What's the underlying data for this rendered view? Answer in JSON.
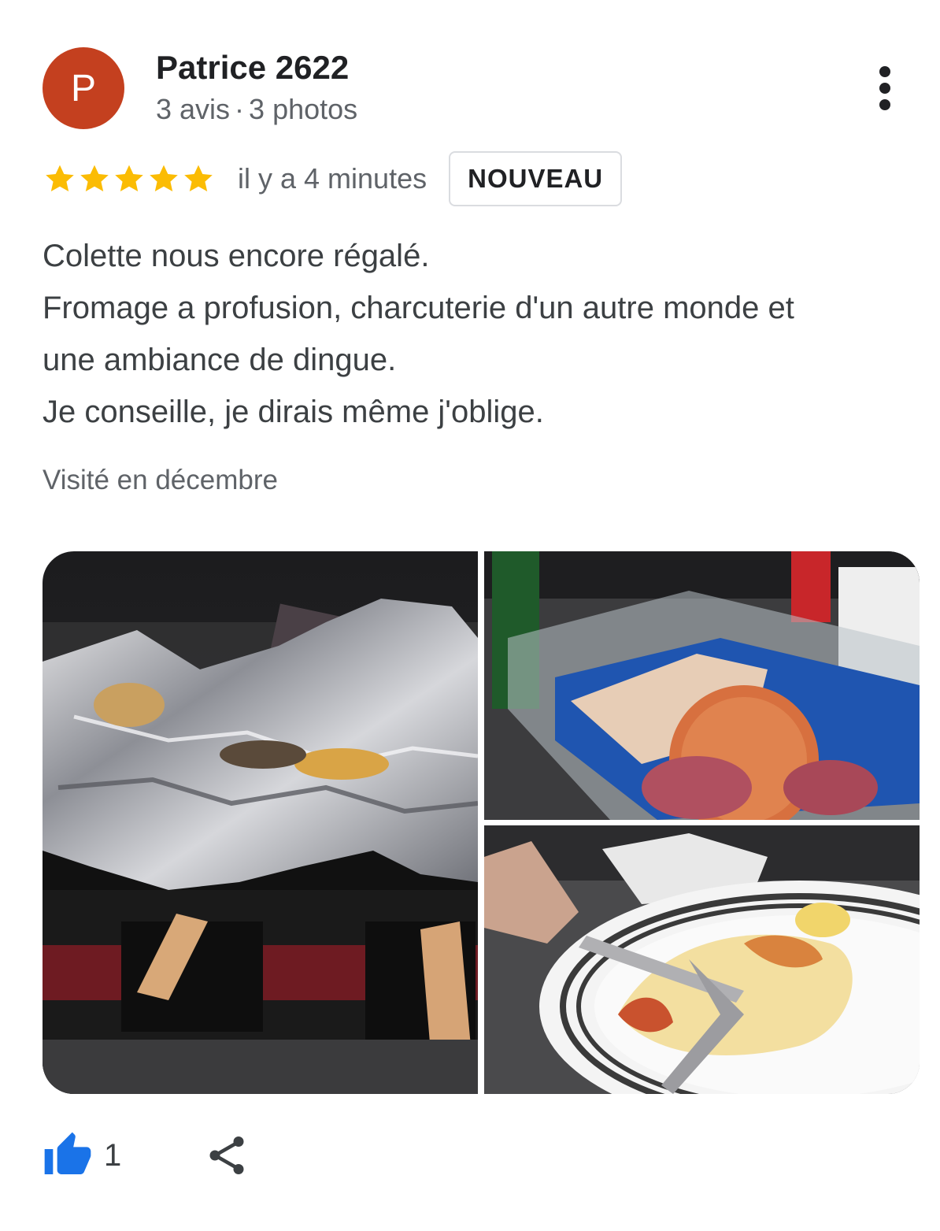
{
  "review": {
    "author": {
      "initial": "P",
      "name": "Patrice 2622",
      "review_count": "3 avis",
      "separator": "·",
      "photo_count": "3 photos",
      "avatar_color": "#c4401f"
    },
    "more_icon": "more-vert-icon",
    "rating": 5,
    "rating_max": 5,
    "star_color": "#fbbc04",
    "time": "il y a 4 minutes",
    "badge": "NOUVEAU",
    "text_lines": [
      "Colette nous encore régalé.",
      "Fromage a profusion, charcuterie d'un autre monde et",
      "une ambiance de dingue.",
      "Je conseille, je dirais même j'oblige."
    ],
    "visited": "Visité en décembre"
  },
  "photos": [
    {
      "subject": "raclette-foil-photo"
    },
    {
      "subject": "charcuterie-box-photo"
    },
    {
      "subject": "raclette-plate-photo"
    }
  ],
  "actions": {
    "like_icon": "thumb-up-icon",
    "like_count": "1",
    "like_color": "#1a73e8",
    "share_icon": "share-icon"
  }
}
